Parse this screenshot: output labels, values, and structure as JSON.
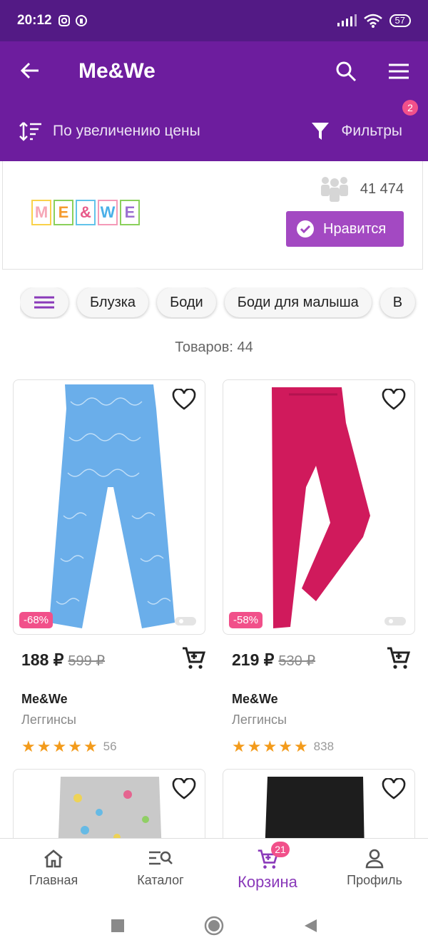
{
  "status_bar": {
    "time": "20:12",
    "battery": "57"
  },
  "app_bar": {
    "title": "Me&We"
  },
  "sort_bar": {
    "sort_label": "По увеличению цены",
    "filter_label": "Фильтры",
    "filter_badge": "2"
  },
  "brand": {
    "logo_letters": [
      "M",
      "E",
      "&",
      "W",
      "E"
    ],
    "followers": "41 474",
    "like_label": "Нравится"
  },
  "chips": [
    "Блузка",
    "Боди",
    "Боди для малыша",
    "В"
  ],
  "product_count": "Товаров: 44",
  "products": [
    {
      "price": "188 ₽",
      "old_price": "599 ₽",
      "discount": "-68%",
      "brand": "Me&We",
      "category": "Леггинсы",
      "rating_count": "56",
      "color": "#6aaeea"
    },
    {
      "price": "219 ₽",
      "old_price": "530 ₽",
      "discount": "-58%",
      "brand": "Me&We",
      "category": "Леггинсы",
      "rating_count": "838",
      "color": "#d01a5c"
    }
  ],
  "bottom_nav": {
    "home": "Главная",
    "catalog": "Каталог",
    "cart": "Корзина",
    "cart_badge": "21",
    "profile": "Профиль"
  },
  "colors": {
    "primary": "#6d1d9e",
    "status_bar": "#531a85",
    "accent": "#a349c2",
    "badge": "#f1508a",
    "star": "#f39b1b"
  }
}
